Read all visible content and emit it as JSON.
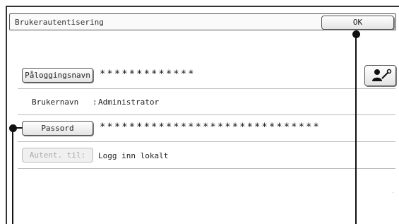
{
  "header": {
    "title": "Brukerautentisering",
    "ok_label": "OK"
  },
  "login": {
    "button_label": "Påloggingsnavn",
    "value": "*************"
  },
  "username": {
    "label": "Brukernavn",
    "separator": ":",
    "value": "Administrator"
  },
  "password": {
    "button_label": "Passord",
    "value": "******************************"
  },
  "auth_target": {
    "button_label": "Autent. til:",
    "value": "Logg inn lokalt"
  },
  "icons": {
    "user_key": "user-key-icon"
  }
}
